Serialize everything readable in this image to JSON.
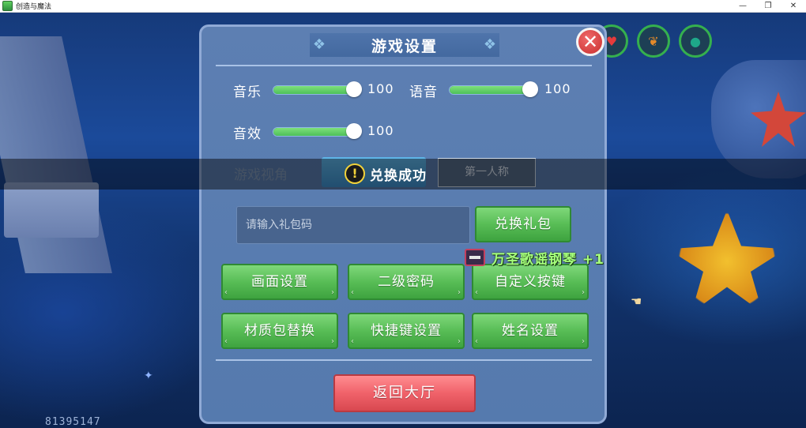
{
  "window": {
    "title": "创造与魔法",
    "controls": {
      "minimize": "—",
      "maximize": "❐",
      "close": "✕"
    }
  },
  "hud": {
    "score": "81395147",
    "icons": [
      "heart-icon",
      "leaf-icon",
      "water-drop-icon"
    ]
  },
  "settings": {
    "title": "游戏设置",
    "close_label": "✕",
    "audio": {
      "music": {
        "label": "音乐",
        "value": "100",
        "level": 1.0
      },
      "voice": {
        "label": "语音",
        "value": "100",
        "level": 1.0
      },
      "sfx": {
        "label": "音效",
        "value": "100",
        "level": 1.0
      }
    },
    "camera": {
      "label": "游戏视角",
      "option_first_person": "第一人称"
    },
    "gift": {
      "placeholder": "请输入礼包码",
      "redeem_label": "兑换礼包"
    },
    "buttons": {
      "graphics": "画面设置",
      "secondary_password": "二级密码",
      "custom_keys": "自定义按键",
      "texture_pack": "材质包替换",
      "hotkeys": "快捷键设置",
      "name": "姓名设置"
    },
    "return_label": "返回大厅"
  },
  "toast": {
    "icon": "!",
    "text": "兑换成功"
  },
  "reward": {
    "text": "万圣歌谣钢琴 +1"
  },
  "colors": {
    "panel": "#5d7fb2",
    "accent_green": "#58bd56",
    "accent_red": "#f0626a",
    "reward_text": "#a6ff7c"
  }
}
